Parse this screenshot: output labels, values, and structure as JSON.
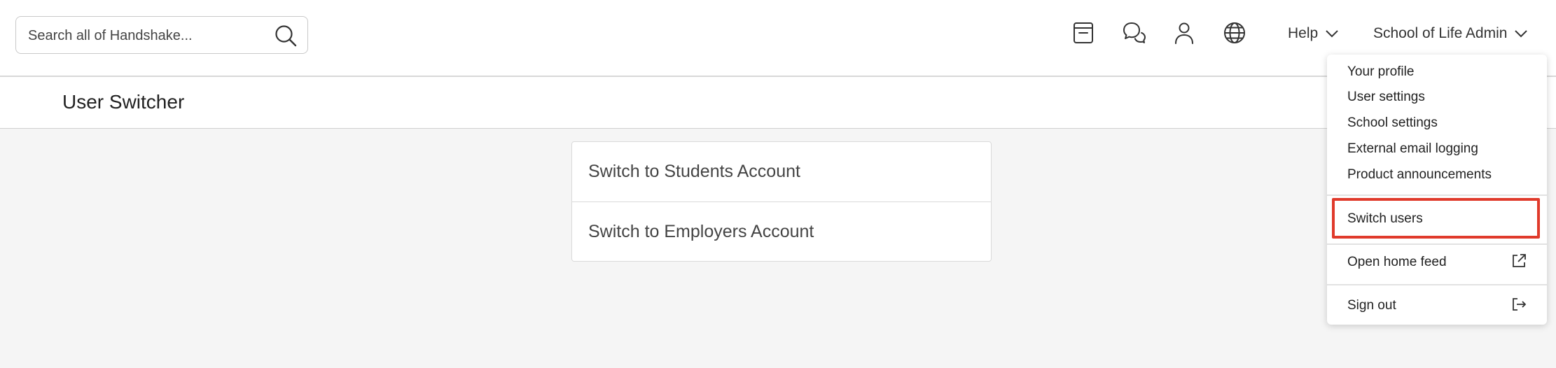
{
  "search": {
    "placeholder": "Search all of Handshake..."
  },
  "header": {
    "icons": [
      "calendar-icon",
      "chat-icon",
      "person-icon",
      "globe-icon"
    ],
    "help_label": "Help",
    "user_menu_label": "School of Life Admin"
  },
  "page": {
    "title": "User Switcher"
  },
  "switch_options": [
    "Switch to Students Account",
    "Switch to Employers Account"
  ],
  "user_menu": {
    "items": [
      "Your profile",
      "User settings",
      "School settings",
      "External email logging",
      "Product announcements"
    ],
    "switch_users": "Switch users",
    "open_home_feed": "Open home feed",
    "sign_out": "Sign out"
  },
  "colors": {
    "highlight": "#e03a2b",
    "page_background": "#f5f5f5"
  }
}
